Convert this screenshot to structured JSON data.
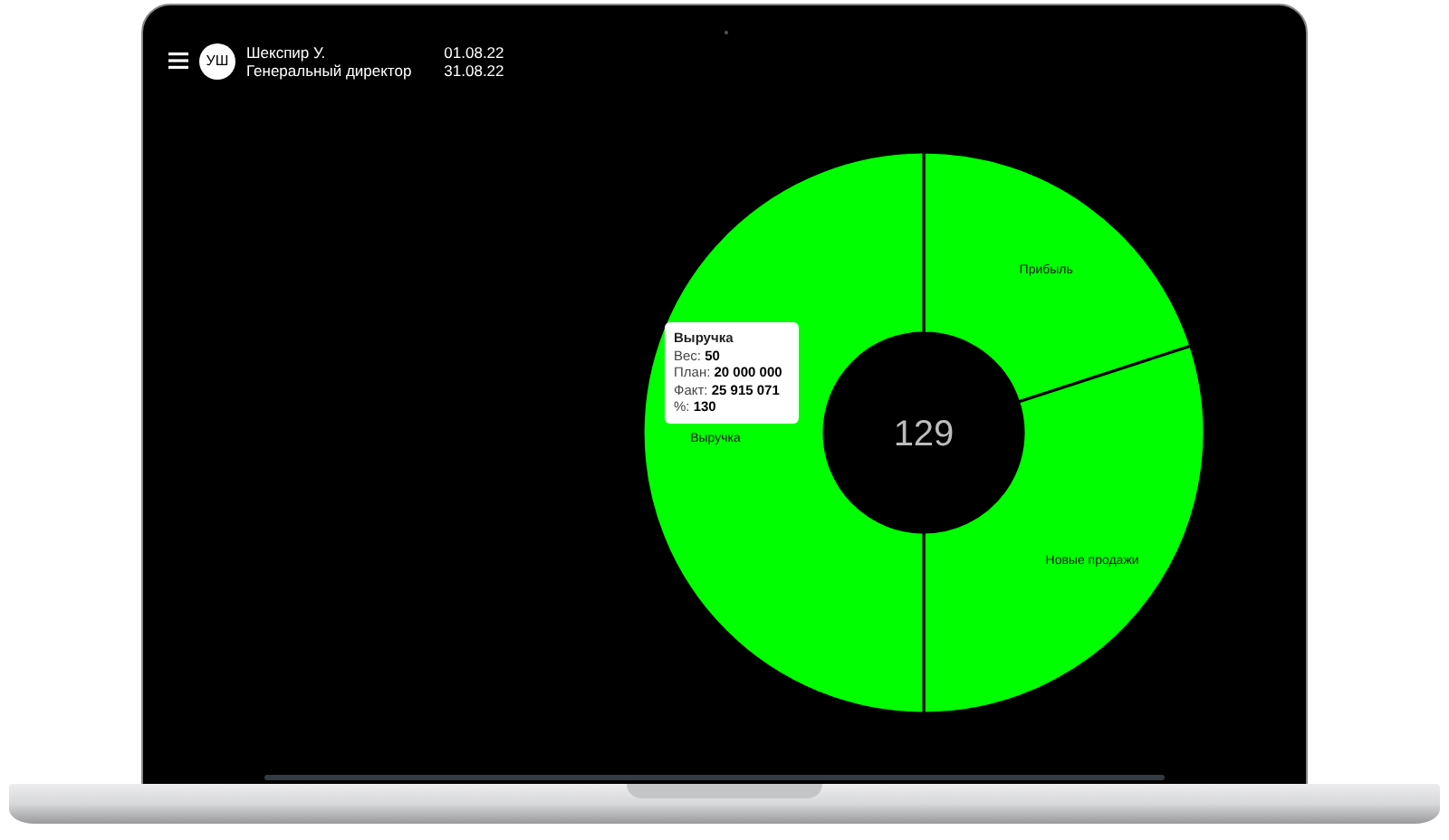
{
  "header": {
    "avatar": "УШ",
    "user_name": "Шекспир У.",
    "user_role": "Генеральный директор",
    "date_from": "01.08.22",
    "date_to": "31.08.22"
  },
  "chart": {
    "center_value": "129",
    "chart_data": {
      "type": "donut",
      "categories": [
        "Прибыль",
        "Новые продажи",
        "Выручка"
      ],
      "values": [
        20,
        30,
        50
      ]
    },
    "tooltip": {
      "title": "Выручка",
      "lines": [
        "Вес: **50**",
        "План: **20 000 000**",
        "Факт: **25 915 071**",
        "%: **130**"
      ]
    }
  }
}
